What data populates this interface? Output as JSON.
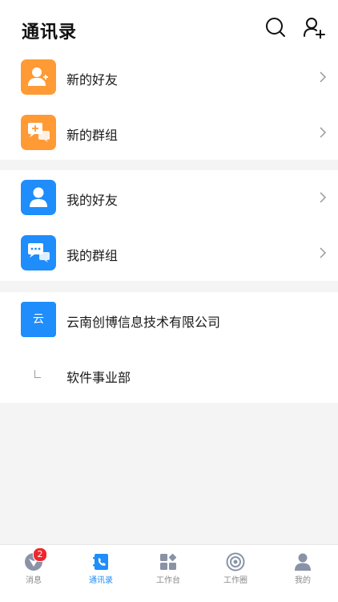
{
  "header": {
    "title": "通讯录",
    "search_icon": "search-icon",
    "add_friend_icon": "add-friend-icon"
  },
  "quick_sections": [
    {
      "items": [
        {
          "label": "新的好友",
          "icon": "new-friend-icon",
          "color": "#ff9a35"
        },
        {
          "label": "新的群组",
          "icon": "new-group-icon",
          "color": "#ff9a35"
        }
      ]
    },
    {
      "items": [
        {
          "label": "我的好友",
          "icon": "friend-icon",
          "color": "#1f8dfb"
        },
        {
          "label": "我的群组",
          "icon": "group-chat-icon",
          "color": "#1f8dfb"
        }
      ]
    }
  ],
  "organization": {
    "avatar_text": "云",
    "name": "云南创博信息技术有限公司",
    "departments": [
      {
        "name": "软件事业部"
      }
    ]
  },
  "tabbar": {
    "tabs": [
      {
        "label": "消息",
        "icon": "message-icon",
        "badge": "2",
        "active": false
      },
      {
        "label": "通讯录",
        "icon": "contacts-icon",
        "active": true
      },
      {
        "label": "工作台",
        "icon": "workbench-icon",
        "active": false
      },
      {
        "label": "工作圈",
        "icon": "work-circle-icon",
        "active": false
      },
      {
        "label": "我的",
        "icon": "profile-icon",
        "active": false
      }
    ]
  },
  "colors": {
    "accent": "#1f8dfb",
    "orange": "#ff9a35",
    "badge": "#f0252c",
    "inactive": "#8a8a8a"
  }
}
